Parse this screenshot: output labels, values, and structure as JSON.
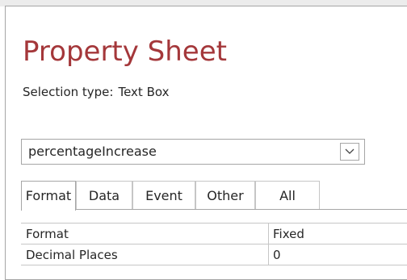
{
  "property_sheet": {
    "title": "Property Sheet",
    "selection_type_label": "Selection type:",
    "selection_type_value": "Text Box",
    "title_color": "#a4373a",
    "object_selector": {
      "value": "percentageIncrease",
      "dropdown_icon": "chevron-down-icon"
    },
    "tabs": [
      {
        "label": "Format",
        "active": true
      },
      {
        "label": "Data",
        "active": false
      },
      {
        "label": "Event",
        "active": false
      },
      {
        "label": "Other",
        "active": false
      },
      {
        "label": "All",
        "active": false
      }
    ],
    "properties": [
      {
        "name": "Format",
        "value": "Fixed"
      },
      {
        "name": "Decimal Places",
        "value": "0"
      }
    ]
  }
}
